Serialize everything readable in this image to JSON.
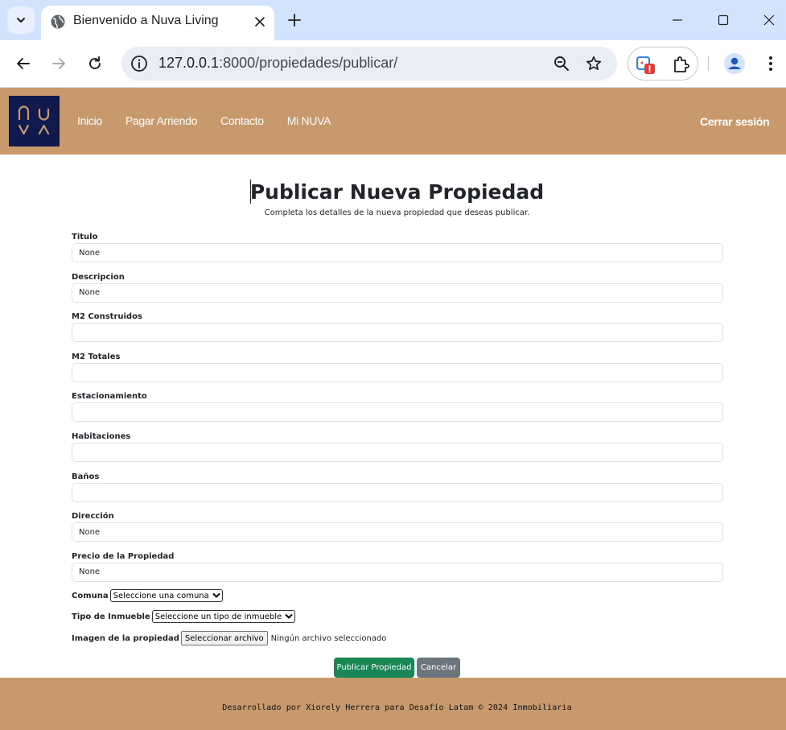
{
  "browser": {
    "tab": {
      "title": "Bienvenido a Nuva Living",
      "icon": "globe-icon"
    },
    "new_tab_icon": "plus-icon",
    "window_controls": [
      "minimize-icon",
      "maximize-icon",
      "close-icon"
    ],
    "address": {
      "host": "127.0.0.1",
      "rest": ":8000/propiedades/publicar/"
    },
    "omnibox_icons": [
      "site-info-icon",
      "zoom-icon",
      "bookmark-star-icon"
    ],
    "extensions": [
      {
        "icon": "extension-error-icon",
        "badge": "!"
      },
      {
        "icon": "puzzle-icon"
      }
    ]
  },
  "site": {
    "logo_text": "NUVA",
    "nav": [
      "Inicio",
      "Pagar Arriendo",
      "Contacto",
      "Mi NUVA"
    ],
    "logout": "Cerrar sesión",
    "colors": {
      "header": "#c8996c",
      "logo_bg": "#101a4e",
      "logo_fg": "#c8996c"
    }
  },
  "page": {
    "title": "Publicar Nueva Propiedad",
    "subtitle": "Completa los detalles de la nueva propiedad que deseas publicar."
  },
  "form": {
    "fields": [
      {
        "label": "Titulo",
        "value": "None"
      },
      {
        "label": "Descripcion",
        "value": "None"
      },
      {
        "label": "M2 Construidos",
        "value": ""
      },
      {
        "label": "M2 Totales",
        "value": ""
      },
      {
        "label": "Estacionamiento",
        "value": ""
      },
      {
        "label": "Habitaciones",
        "value": ""
      },
      {
        "label": "Baños",
        "value": ""
      },
      {
        "label": "Dirección",
        "value": "None"
      },
      {
        "label": "Precio de la Propiedad",
        "value": "None"
      }
    ],
    "comuna": {
      "label": "Comuna",
      "selected": "Seleccione una comuna"
    },
    "tipo": {
      "label": "Tipo de Inmueble",
      "selected": "Seleccione un tipo de inmueble"
    },
    "imagen": {
      "label": "Imagen de la propiedad",
      "button": "Seleccionar archivo",
      "status": "Ningún archivo seleccionado"
    },
    "submit": "Publicar Propiedad",
    "cancel": "Cancelar"
  },
  "footer": {
    "text": "Desarrollado por Xiorely Herrera para Desafío Latam © 2024 Inmobiliaria"
  }
}
